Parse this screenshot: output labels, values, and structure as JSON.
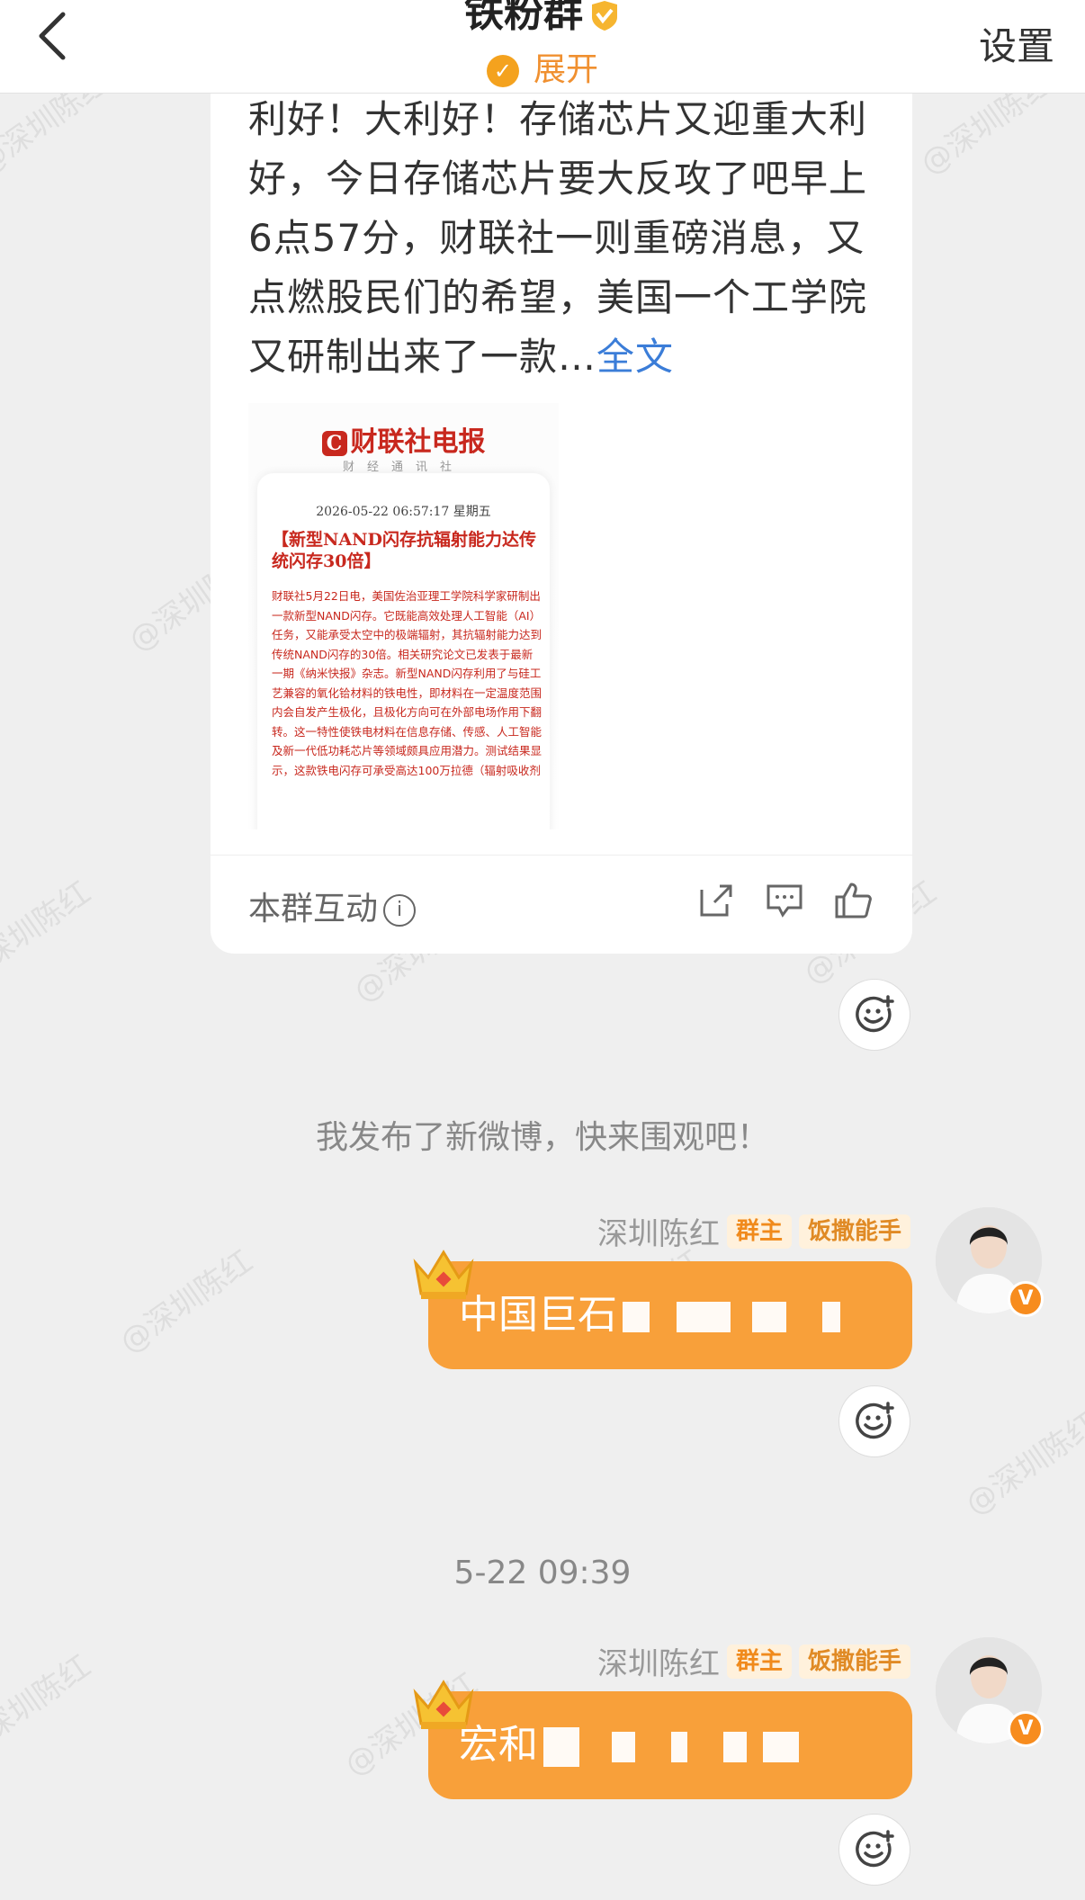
{
  "header": {
    "title": "铁粉群",
    "expand_label": "展开",
    "settings_label": "设置"
  },
  "post": {
    "text": "利好！大利好！存储芯片又迎重大利好，今日存储芯片要大反攻了吧早上6点57分，财联社一则重磅消息，又点燃股民们的希望，美国一个工学院又研制出来了一款…",
    "more_label": "全文",
    "clipping": {
      "logo": "财联社电报",
      "subtitle": "财经通讯社",
      "datetime": "2026-05-22 06:57:17 星期五",
      "headline": "【新型NAND闪存抗辐射能力达传统闪存30倍】",
      "body": "财联社5月22日电，美国佐治亚理工学院科学家研制出一款新型NAND闪存。它既能高效处理人工智能（AI）任务，又能承受太空中的极端辐射，其抗辐射能力达到传统NAND闪存的30倍。相关研究论文已发表于最新一期《纳米快报》杂志。新型NAND闪存利用了与硅工艺兼容的氧化铪材料的铁电性，即材料在一定温度范围内会自发产生极化，且极化方向可在外部电场作用下翻转。这一特性使铁电材料在信息存储、传感、人工智能及新一代低功耗芯片等领域颇具应用潜力。测试结果显示，这款铁电闪存可承受高达100万拉德（辐射吸收剂"
    },
    "footer_label": "本群互动",
    "footer_info_icon": "ⓘ"
  },
  "system_notice": "我发布了新微博，快来围观吧！",
  "timestamp": "5-22 09:39",
  "messages": [
    {
      "sender": "深圳陈红",
      "tag_owner": "群主",
      "tag_medal": "饭撒能手",
      "text": "中国巨石"
    },
    {
      "sender": "深圳陈红",
      "tag_owner": "群主",
      "tag_medal": "饭撒能手",
      "text": "宏和"
    }
  ],
  "watermark": "@深圳陈红",
  "colors": {
    "accent": "#f8a03a",
    "link": "#3b7dd8",
    "background": "#efefef"
  },
  "icons": {
    "back": "chevron-left-icon",
    "share": "share-icon",
    "comment": "comment-icon",
    "like": "thumb-up-icon",
    "react": "emoji-add-icon",
    "crown": "crown-icon",
    "verified": "v-badge-icon"
  }
}
